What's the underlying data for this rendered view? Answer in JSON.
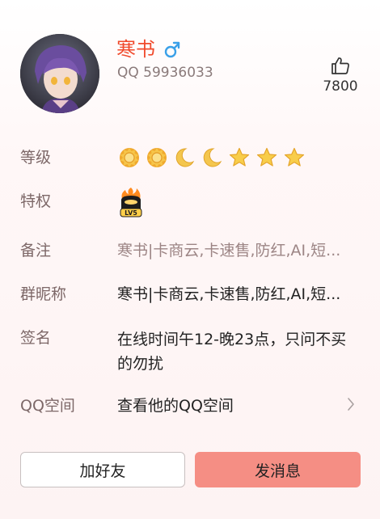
{
  "profile": {
    "name": "寒书",
    "gender_icon": "male-icon",
    "qq_label": "QQ 59936033",
    "likes": "7800",
    "like_icon": "thumbs-up-icon"
  },
  "rows": {
    "level": {
      "label": "等级",
      "icons": [
        "sun-icon",
        "sun-icon",
        "moon-icon",
        "moon-icon",
        "star-icon",
        "star-icon",
        "star-icon"
      ]
    },
    "privilege": {
      "label": "特权",
      "badge_text": "LV5",
      "badge_icon": "vip-badge-icon"
    },
    "remark": {
      "label": "备注",
      "value": "寒书|卡商云,卡速售,防红,AI,短..."
    },
    "group_nick": {
      "label": "群昵称",
      "value": "寒书|卡商云,卡速售,防红,AI,短..."
    },
    "signature": {
      "label": "签名",
      "value": "在线时间午12-晚23点，只问不买的勿扰"
    },
    "qzone": {
      "label": "QQ空间",
      "value": "查看他的QQ空间"
    }
  },
  "buttons": {
    "add_friend": "加好友",
    "send_message": "发消息"
  },
  "colors": {
    "name": "#f04a2c",
    "gender": "#3aa0e8",
    "primary_button": "#f58e84",
    "label": "#7d6868"
  }
}
